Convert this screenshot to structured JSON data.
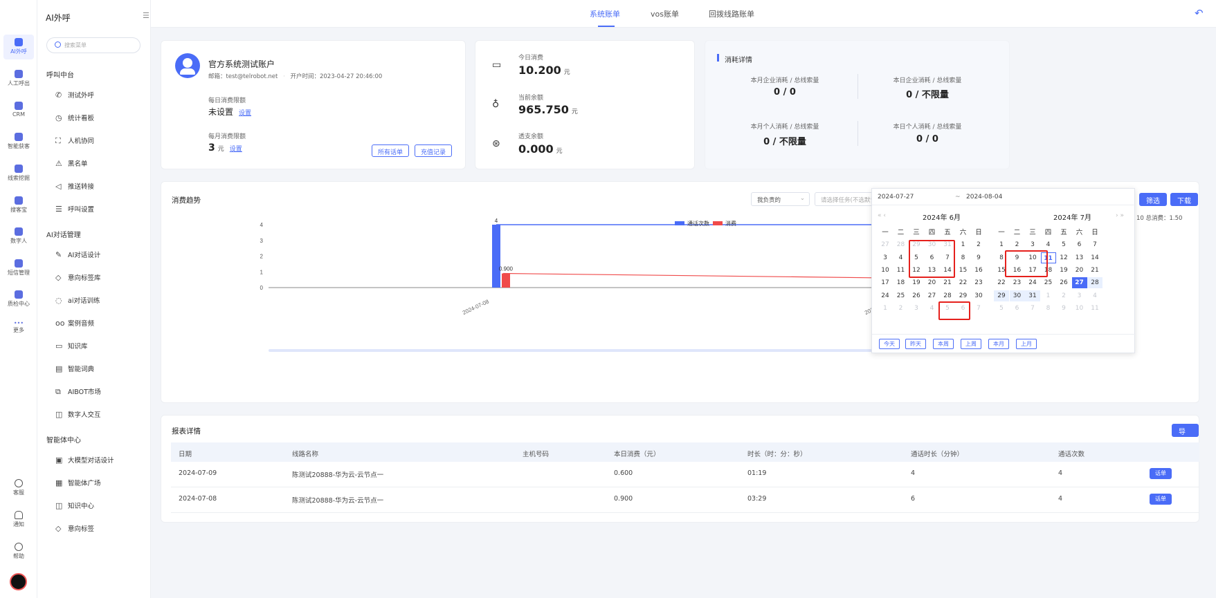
{
  "rail": {
    "items": [
      {
        "label": "AI外呼"
      },
      {
        "label": "人工呼出"
      },
      {
        "label": "CRM"
      },
      {
        "label": "智能获客"
      },
      {
        "label": "线索挖掘"
      },
      {
        "label": "搜客宝"
      },
      {
        "label": "数字人"
      },
      {
        "label": "短信管理"
      },
      {
        "label": "质检中心"
      },
      {
        "label": "更多"
      }
    ],
    "bottom": [
      {
        "label": "客服"
      },
      {
        "label": "通知"
      },
      {
        "label": "帮助"
      }
    ],
    "more_glyph": "•••"
  },
  "menu": {
    "title": "AI外呼",
    "search_placeholder": "搜索菜单",
    "groups": [
      {
        "label": "呼叫中台",
        "items": [
          "测试外呼",
          "统计看板",
          "人机协同",
          "黑名单",
          "推送转接",
          "呼叫设置"
        ]
      },
      {
        "label": "AI对话管理",
        "items": [
          "AI对话设计",
          "意向标签库",
          "ai对话训练",
          "案例音频",
          "知识库",
          "智能词典",
          "AIBOT市场",
          "数字人交互"
        ]
      },
      {
        "label": "智能体中心",
        "items": [
          "大模型对话设计",
          "智能体广场",
          "知识中心",
          "意向标签"
        ]
      }
    ]
  },
  "tabs": [
    "系统账单",
    "vos账单",
    "回拨线路账单"
  ],
  "account": {
    "name": "官方系统测试账户",
    "email_label": "邮箱：",
    "email": "test@telrobot.net",
    "open_label": "开户时间：",
    "open_time": "2023-04-27 20:46:00",
    "daily_limit_label": "每日消费限额",
    "daily_limit_value": "未设置",
    "monthly_limit_label": "每月消费限额",
    "monthly_limit_value": "3",
    "unit": "元",
    "set_link": "设置",
    "btn_all_bills": "所有话单",
    "btn_recharge": "充值记录"
  },
  "balance": {
    "today_label": "今日消费",
    "today_value": "10.200",
    "current_label": "当前余额",
    "current_value": "965.750",
    "overdraft_label": "透支余额",
    "overdraft_value": "0.000",
    "unit": "元"
  },
  "consumption": {
    "title": "消耗详情",
    "stats": [
      {
        "label": "本月企业消耗 / 总线索量",
        "value": "0 / 0"
      },
      {
        "label": "本日企业消耗 / 总线索量",
        "value": "0 / 不限量"
      },
      {
        "label": "本月个人消耗 / 总线索量",
        "value": "0 / 不限量"
      },
      {
        "label": "本日个人消耗 / 总线索量",
        "value": "0 / 0"
      }
    ]
  },
  "trend": {
    "title": "消费趋势",
    "owner_select": "我负责的",
    "task_placeholder": "请选择任务(不选默认全部)",
    "btn_filter": "筛选",
    "btn_download": "下载",
    "summary": "数：10  总消费：1.50"
  },
  "chart_data": {
    "type": "bar",
    "categories": [
      "2024-07-08",
      "2024-07-09"
    ],
    "series": [
      {
        "name": "通话次数",
        "values": [
          4,
          4
        ],
        "color": "#4a6cf7"
      },
      {
        "name": "消费",
        "values": [
          0.9,
          0.6
        ],
        "color": "#f04a4a"
      }
    ],
    "ylim": [
      0,
      4
    ],
    "yticks": [
      "0",
      "1",
      "2",
      "3",
      "4"
    ],
    "data_labels": [
      "4",
      "0.900"
    ],
    "legend": "top-center",
    "overlay_lines": true
  },
  "datepicker": {
    "start": "2024-07-27",
    "sep": "~",
    "end": "2024-08-04",
    "left_month": "2024年 6月",
    "right_month": "2024年 7月",
    "weekdays": [
      "一",
      "二",
      "三",
      "四",
      "五",
      "六",
      "日"
    ],
    "prev_glyph": "« ‹",
    "next_glyph": "› »",
    "left_days": [
      [
        "27",
        "28",
        "29",
        "30",
        "31",
        "1",
        "2"
      ],
      [
        "3",
        "4",
        "5",
        "6",
        "7",
        "8",
        "9"
      ],
      [
        "10",
        "11",
        "12",
        "13",
        "14",
        "15",
        "16"
      ],
      [
        "17",
        "18",
        "19",
        "20",
        "21",
        "22",
        "23"
      ],
      [
        "24",
        "25",
        "26",
        "27",
        "28",
        "29",
        "30"
      ],
      [
        "1",
        "2",
        "3",
        "4",
        "5",
        "6",
        "7"
      ]
    ],
    "right_days": [
      [
        "1",
        "2",
        "3",
        "4",
        "5",
        "6",
        "7"
      ],
      [
        "8",
        "9",
        "10",
        "11",
        "12",
        "13",
        "14"
      ],
      [
        "15",
        "16",
        "17",
        "18",
        "19",
        "20",
        "21"
      ],
      [
        "22",
        "23",
        "24",
        "25",
        "26",
        "27",
        "28"
      ],
      [
        "29",
        "30",
        "31",
        "1",
        "2",
        "3",
        "4"
      ],
      [
        "5",
        "6",
        "7",
        "8",
        "9",
        "10",
        "11"
      ]
    ],
    "quick": [
      "今天",
      "昨天",
      "本周",
      "上周",
      "本月",
      "上月"
    ]
  },
  "report": {
    "title": "报表详情",
    "btn_export": "导出",
    "columns": [
      "日期",
      "线路名称",
      "主机号码",
      "本日消费（元）",
      "时长（时：分：秒）",
      "通话时长（分钟）",
      "通话次数"
    ],
    "rows": [
      {
        "date": "2024-07-09",
        "line": "陈测试20888-华为云-云节点一",
        "host": "",
        "cost": "0.600",
        "duration": "01:19",
        "minutes": "4",
        "calls": "4",
        "action": "话单"
      },
      {
        "date": "2024-07-08",
        "line": "陈测试20888-华为云-云节点一",
        "host": "",
        "cost": "0.900",
        "duration": "03:29",
        "minutes": "6",
        "calls": "4",
        "action": "话单"
      }
    ]
  },
  "colors": {
    "accent": "#4a6cf7",
    "consume": "#f04a4a",
    "highlight": "#e5201c"
  }
}
